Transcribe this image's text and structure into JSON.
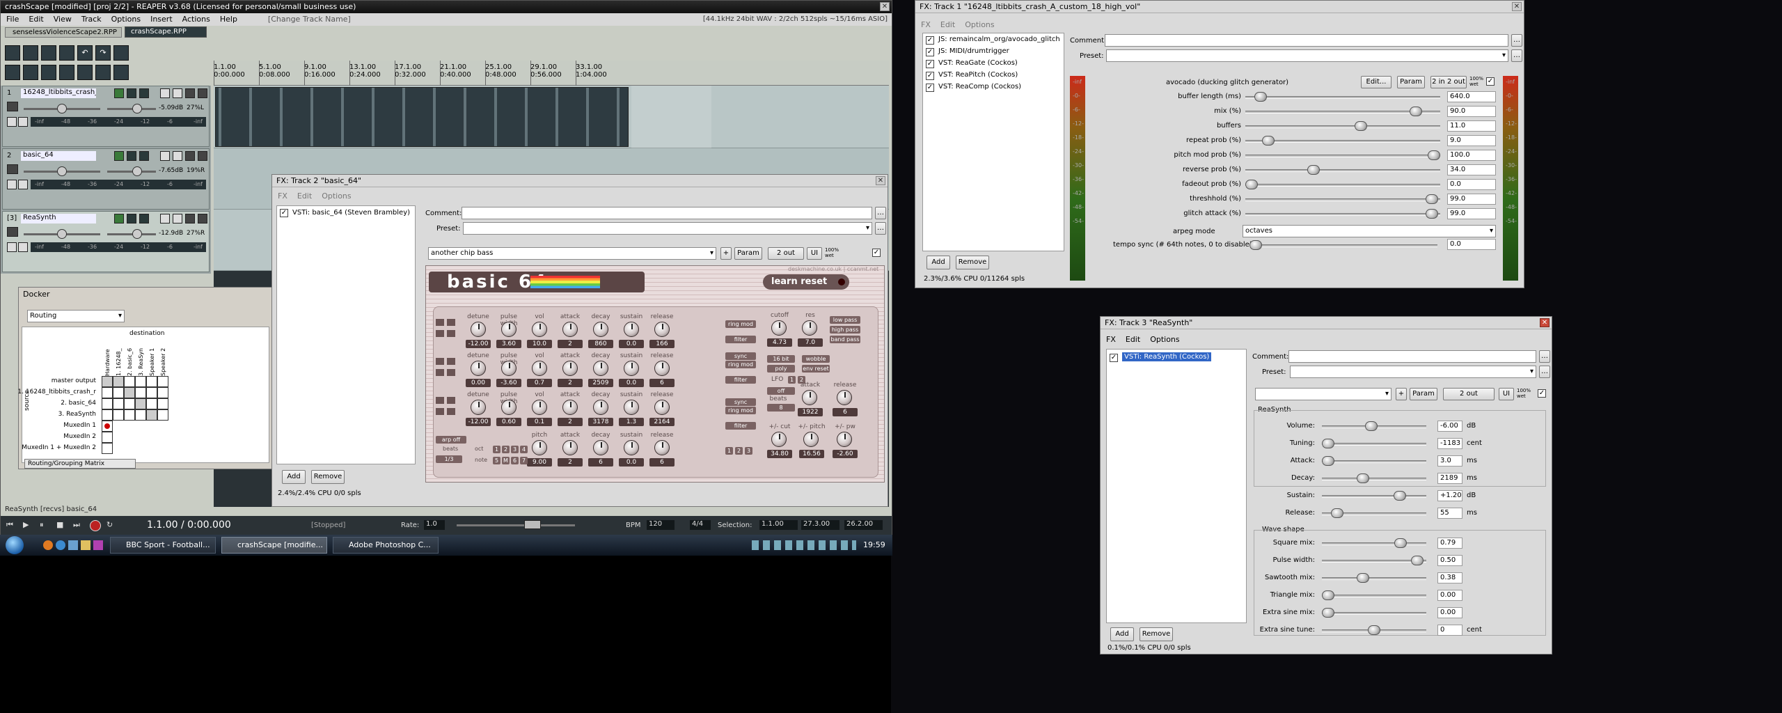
{
  "reaper": {
    "title": "crashScape [modified] [proj 2/2] - REAPER v3.68 (Licensed for personal/small business use)",
    "menu": [
      "File",
      "Edit",
      "View",
      "Track",
      "Options",
      "Insert",
      "Actions",
      "Help"
    ],
    "change_track_name": "[Change Track Name]",
    "audio_info": "[44.1kHz 24bit WAV : 2/2ch 512spls ~15/16ms ASIO]",
    "tabs": [
      "senselessViolenceScape2.RPP",
      "crashScape.RPP"
    ],
    "ruler": [
      {
        "bar": "1.1.00",
        "time": "0:00.000"
      },
      {
        "bar": "5.1.00",
        "time": "0:08.000"
      },
      {
        "bar": "9.1.00",
        "time": "0:16.000"
      },
      {
        "bar": "13.1.00",
        "time": "0:24.000"
      },
      {
        "bar": "17.1.00",
        "time": "0:32.000"
      },
      {
        "bar": "21.1.00",
        "time": "0:40.000"
      },
      {
        "bar": "25.1.00",
        "time": "0:48.000"
      },
      {
        "bar": "29.1.00",
        "time": "0:56.000"
      },
      {
        "bar": "33.1.00",
        "time": "1:04.000"
      }
    ],
    "tracks": [
      {
        "num": "1",
        "name": "16248_ltibbits_crash_",
        "vol": "-5.09dB",
        "pan": "27%L",
        "meter": [
          "-inf",
          "-48",
          "-36",
          "-24",
          "-12",
          "-6",
          "-inf"
        ]
      },
      {
        "num": "2",
        "name": "basic_64",
        "vol": "-7.65dB",
        "pan": "19%R",
        "meter": [
          "-inf",
          "-48",
          "-36",
          "-24",
          "-12",
          "-6",
          "-inf"
        ]
      },
      {
        "num": "[3]",
        "name": "ReaSynth",
        "vol": "-12.9dB",
        "pan": "27%R",
        "meter": [
          "-inf",
          "-48",
          "-36",
          "-24",
          "-12",
          "-6",
          "-inf"
        ]
      }
    ],
    "status_left": "ReaSynth [recvs] basic_64",
    "transport_time": "1.1.00 / 0:00.000",
    "transport_state": "[Stopped]",
    "rate_label": "Rate:",
    "rate": "1.0",
    "bpm_label": "BPM",
    "bpm": "120",
    "timesig": "4/4",
    "selection_label": "Selection:",
    "sel_start": "1.1.00",
    "sel_end": "27.3.00",
    "sel_len": "26.2.00"
  },
  "docker": {
    "title": "Docker",
    "mode": "Routing",
    "destination": "destination",
    "source": "source",
    "cols": [
      "Hardware",
      "1. 16248_",
      "2. basic_6",
      "3. ReaSyn",
      "Speaker 1",
      "Speaker 2"
    ],
    "rows": [
      "master output",
      "1. 16248_ltibbits_crash_r",
      "2. basic_64",
      "3. ReaSynth",
      "MuxedIn 1",
      "MuxedIn 2",
      "MuxedIn 1 + MuxedIn 2"
    ],
    "tab": "Routing/Grouping Matrix"
  },
  "fx2": {
    "title": "FX: Track 2 \"basic_64\"",
    "menu": [
      "FX",
      "Edit",
      "Options"
    ],
    "plugins": [
      "VSTi: basic_64 (Steven Brambley)"
    ],
    "comment_label": "Comment:",
    "preset_label": "Preset:",
    "preset": "another chip bass",
    "param_btn": "Param",
    "out_btn": "2 out",
    "ui_btn": "UI",
    "wet": "100% wet",
    "add": "Add",
    "remove": "Remove",
    "cpu": "2.4%/2.4% CPU 0/0 spls",
    "logo": "basic 64",
    "url": "deskmachine.co.uk | ccanmt.net",
    "learn_reset": "learn reset",
    "rows": [
      {
        "labels": [
          "detune",
          "pulse width",
          "vol",
          "attack",
          "decay",
          "sustain",
          "release"
        ],
        "vals": [
          "-12.00",
          "3.60",
          "10.0",
          "2",
          "860",
          "0.0",
          "166"
        ]
      },
      {
        "labels": [
          "detune",
          "pulse width",
          "vol",
          "attack",
          "decay",
          "sustain",
          "release"
        ],
        "vals": [
          "0.00",
          "-3.60",
          "0.7",
          "2",
          "2509",
          "0.0",
          "6"
        ]
      },
      {
        "labels": [
          "detune",
          "pulse width",
          "vol",
          "attack",
          "decay",
          "sustain",
          "release"
        ],
        "vals": [
          "-12.00",
          "0.60",
          "0.1",
          "2",
          "3178",
          "1.3",
          "2164"
        ]
      }
    ],
    "row4": {
      "labels": [
        "pitch",
        "attack",
        "decay",
        "sustain",
        "release"
      ],
      "vals": [
        "9.00",
        "2",
        "6",
        "0.0",
        "6"
      ]
    },
    "ring": [
      "ring mod",
      "filter",
      "sync",
      "ring mod",
      "filter",
      "sync",
      "ring mod",
      "filter"
    ],
    "cutoff": "cutoff",
    "res": "res",
    "cutoff_v": "4.73",
    "res_v": "7.0",
    "filters": [
      "low pass",
      "high pass",
      "band pass"
    ],
    "bit": "16 bit",
    "wobble": "wobble",
    "poly": "poly",
    "env_reset": "env reset",
    "lfo": "LFO",
    "lfo_n": [
      "1",
      "2"
    ],
    "off": "off",
    "beats": "beats",
    "beats_v": "8",
    "attack2": "attack",
    "attack2_v": "1922",
    "release2": "release",
    "release2_v": "6",
    "cut": "+/- cut",
    "cut_v": "34.80",
    "pitch2": "+/- pitch",
    "pitch2_v": "16.56",
    "pw2": "+/- pw",
    "pw2_v": "-2.60",
    "arp": "arp off",
    "oct": "oct",
    "note": "note",
    "beats3": "beats",
    "beats3_v": "1/3",
    "oct_n": [
      "1",
      "2",
      "3",
      "4"
    ],
    "note_n": [
      "5",
      "M",
      "6",
      "7"
    ],
    "dest_n": [
      "1",
      "2",
      "3"
    ]
  },
  "fx1": {
    "title": "FX: Track 1 \"16248_ltibbits_crash_A_custom_18_high_vol\"",
    "menu": [
      "FX",
      "Edit",
      "Options"
    ],
    "plugins": [
      "JS: remaincalm_org/avocado_glitch",
      "JS: MIDI/drumtrigger",
      "VST: ReaGate (Cockos)",
      "VST: ReaPitch (Cockos)",
      "VST: ReaComp (Cockos)"
    ],
    "comment_label": "Comment:",
    "preset_label": "Preset:",
    "plugin_name": "avocado (ducking glitch generator)",
    "edit_btn": "Edit...",
    "param_btn": "Param",
    "io_btn": "2 in 2 out",
    "wet": "100% wet",
    "params": [
      {
        "label": "buffer length (ms)",
        "value": "640.0",
        "pos": 0.05
      },
      {
        "label": "mix (%)",
        "value": "90.0",
        "pos": 0.9
      },
      {
        "label": "buffers",
        "value": "11.0",
        "pos": 0.6
      },
      {
        "label": "repeat prob (%)",
        "value": "9.0",
        "pos": 0.09
      },
      {
        "label": "pitch mod prob (%)",
        "value": "100.0",
        "pos": 1.0
      },
      {
        "label": "reverse prob (%)",
        "value": "34.0",
        "pos": 0.34
      },
      {
        "label": "fadeout prob (%)",
        "value": "0.0",
        "pos": 0.0
      },
      {
        "label": "threshhold (%)",
        "value": "99.0",
        "pos": 0.99
      },
      {
        "label": "glitch attack (%)",
        "value": "99.0",
        "pos": 0.99
      }
    ],
    "arpeg_label": "arpeg mode",
    "arpeg_value": "octaves",
    "tempo_label": "tempo sync (# 64th notes, 0 to disable)",
    "tempo_value": "0.0",
    "meter_labels": [
      "-inf",
      "-0-",
      "-6-",
      "-12-",
      "-18-",
      "-24-",
      "-30-",
      "-36-",
      "-42-",
      "-48-",
      "-54-"
    ],
    "add": "Add",
    "remove": "Remove",
    "cpu": "2.3%/3.6% CPU 0/11264 spls"
  },
  "fx3": {
    "title": "FX: Track 3 \"ReaSynth\"",
    "menu": [
      "FX",
      "Edit",
      "Options"
    ],
    "plugins": [
      "VSTi: ReaSynth (Cockos)"
    ],
    "comment_label": "Comment:",
    "preset_label": "Preset:",
    "param_btn": "Param",
    "out_btn": "2 out",
    "ui_btn": "UI",
    "wet": "100% wet",
    "group": "ReaSynth",
    "params": [
      {
        "label": "Volume:",
        "value": "-6.00",
        "unit": "dB",
        "pos": 0.47
      },
      {
        "label": "Tuning:",
        "value": "-1183",
        "unit": "cent",
        "pos": 0.0
      },
      {
        "label": "Attack:",
        "value": "3.0",
        "unit": "ms",
        "pos": 0.0
      },
      {
        "label": "Decay:",
        "value": "2189",
        "unit": "ms",
        "pos": 0.38
      },
      {
        "label": "Sustain:",
        "value": "+1.20",
        "unit": "dB",
        "pos": 0.78
      },
      {
        "label": "Release:",
        "value": "55",
        "unit": "ms",
        "pos": 0.1
      }
    ],
    "wave_group": "Wave shape",
    "wave": [
      {
        "label": "Square mix:",
        "value": "0.79",
        "unit": "",
        "pos": 0.79
      },
      {
        "label": "Pulse width:",
        "value": "0.50",
        "unit": "",
        "pos": 0.97
      },
      {
        "label": "Sawtooth mix:",
        "value": "0.38",
        "unit": "",
        "pos": 0.38
      },
      {
        "label": "Triangle mix:",
        "value": "0.00",
        "unit": "",
        "pos": 0.0
      },
      {
        "label": "Extra sine mix:",
        "value": "0.00",
        "unit": "",
        "pos": 0.0
      },
      {
        "label": "Extra sine tune:",
        "value": "0",
        "unit": "cent",
        "pos": 0.5
      }
    ],
    "add": "Add",
    "remove": "Remove",
    "cpu": "0.1%/0.1% CPU 0/0 spls"
  },
  "taskbar": {
    "items": [
      "BBC Sport - Football...",
      "crashScape [modifie...",
      "Adobe Photoshop C..."
    ],
    "clock": "19:59"
  }
}
